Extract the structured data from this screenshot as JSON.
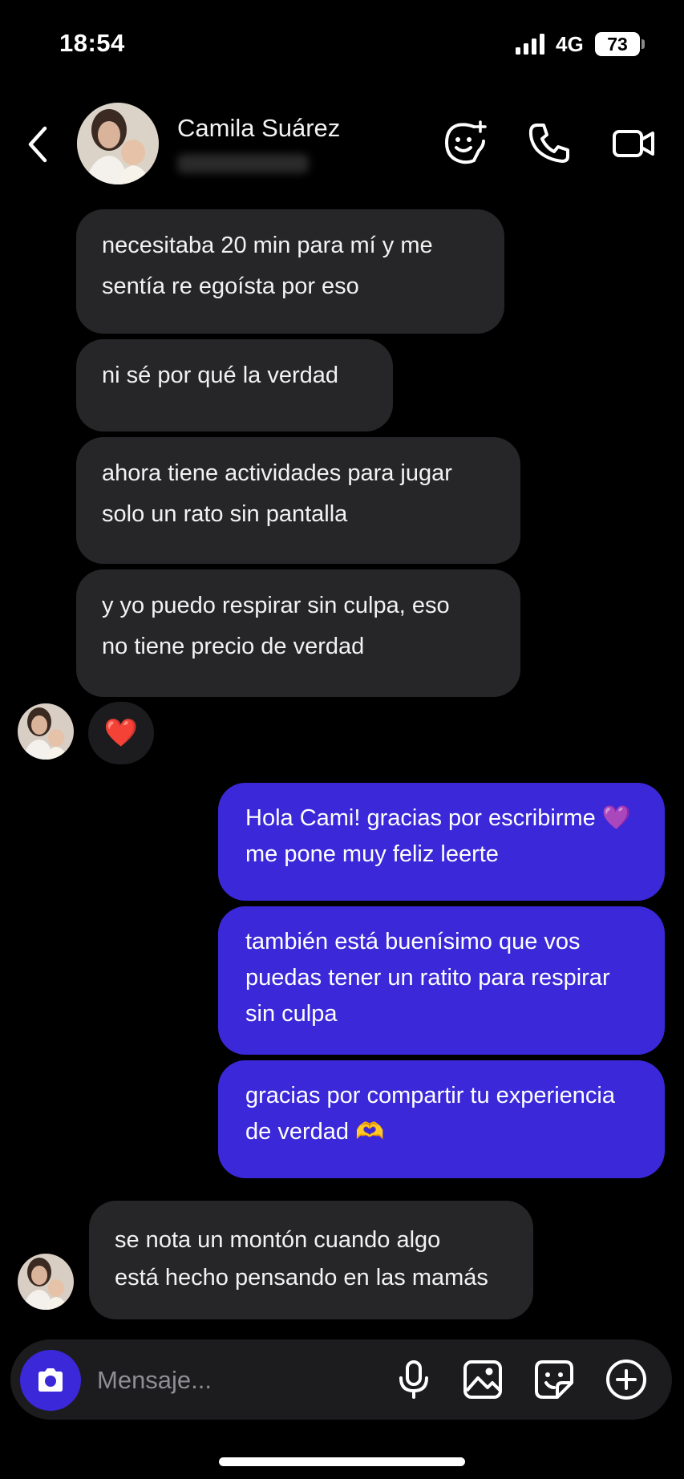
{
  "status_bar": {
    "time": "18:54",
    "network": "4G",
    "battery": "73"
  },
  "header": {
    "contact_name": "Camila Suárez"
  },
  "messages": [
    {
      "sender": "contact",
      "text": "necesitaba 20 min para mí y me\nsentía re egoísta por eso"
    },
    {
      "sender": "contact",
      "text": "ni sé por qué la verdad"
    },
    {
      "sender": "contact",
      "text": "ahora tiene actividades para jugar\nsolo un rato sin pantalla"
    },
    {
      "sender": "contact",
      "text": "y yo puedo respirar sin culpa, eso\nno tiene precio de verdad"
    },
    {
      "sender": "me",
      "text": "Hola Cami! gracias por escribirme 💜\nme pone muy feliz leerte"
    },
    {
      "sender": "me",
      "text": "también está buenísimo que vos\npuedas tener un ratito para respirar\nsin culpa"
    },
    {
      "sender": "me",
      "text": "gracias por compartir tu experiencia\nde verdad 🫶"
    },
    {
      "sender": "contact",
      "text": "se nota un montón cuando algo\nestá hecho pensando en las mamás"
    }
  ],
  "reaction": {
    "emoji": "❤️"
  },
  "composer": {
    "placeholder": "Mensaje..."
  },
  "colors": {
    "background": "#000000",
    "incoming_bubble": "#262628",
    "outgoing_bubble": "#3b28d9",
    "accent": "#3b28d9"
  },
  "icons": {
    "back": "chevron-left-icon",
    "effects": "face-sparkle-icon",
    "call": "phone-icon",
    "video": "video-camera-icon",
    "camera": "camera-icon",
    "mic": "microphone-icon",
    "gallery": "image-icon",
    "sticker": "sticker-icon",
    "more": "plus-circle-icon"
  }
}
